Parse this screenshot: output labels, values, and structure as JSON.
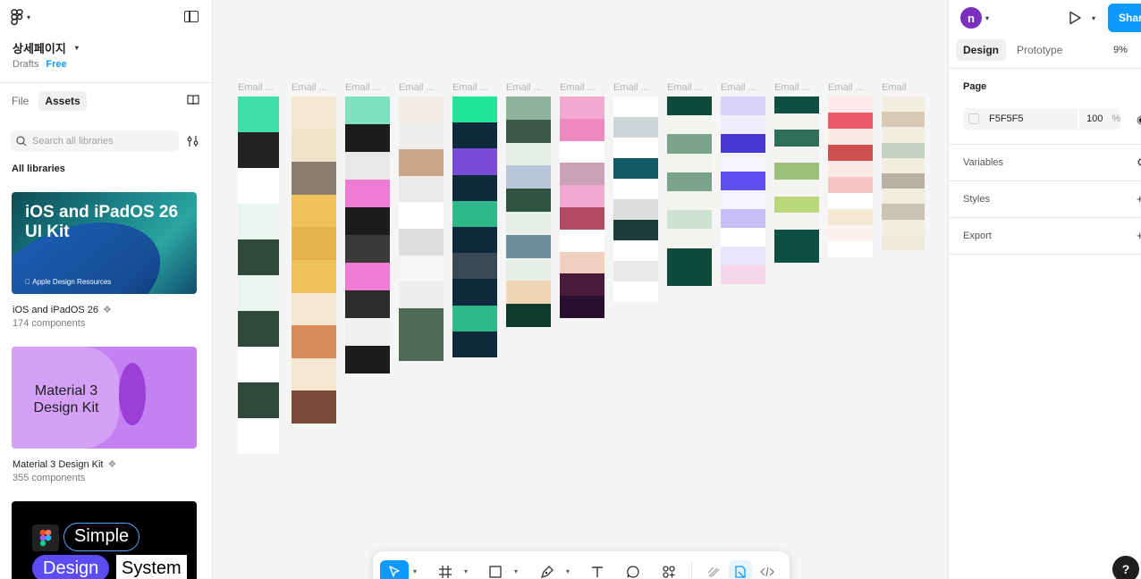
{
  "left_panel": {
    "file_title": "상세페이지",
    "location": "Drafts",
    "plan": "Free",
    "tabs": [
      {
        "label": "File",
        "active": false
      },
      {
        "label": "Assets",
        "active": true
      }
    ],
    "search_placeholder": "Search all libraries",
    "section_heading": "All libraries",
    "libraries": [
      {
        "name": "iOS and iPadOS 26",
        "count": "174 components",
        "thumb_title": "iOS and iPadOS 26 UI Kit",
        "thumb_caption": "Apple Design Resources"
      },
      {
        "name": "Material 3 Design Kit",
        "count": "355 components",
        "thumb_title": "Material 3 Design Kit"
      },
      {
        "name": "Simple Design System",
        "thumb_words": [
          "Simple",
          "Design",
          "System"
        ]
      }
    ]
  },
  "canvas": {
    "frames": [
      {
        "label": "Email ...",
        "theme": "green-stripes"
      },
      {
        "label": "Email ...",
        "theme": "beige-art"
      },
      {
        "label": "Email ...",
        "theme": "dark-pink"
      },
      {
        "label": "Email ...",
        "theme": "skincare"
      },
      {
        "label": "Email ...",
        "theme": "navy-green"
      },
      {
        "label": "Email ...",
        "theme": "travel"
      },
      {
        "label": "Email ...",
        "theme": "black-friday"
      },
      {
        "label": "Email ...",
        "theme": "teal-business"
      },
      {
        "label": "Email ...",
        "theme": "plants"
      },
      {
        "label": "Email ...",
        "theme": "purple-app"
      },
      {
        "label": "Email ...",
        "theme": "eco"
      },
      {
        "label": "Email ...",
        "theme": "valentine"
      },
      {
        "label": "Email",
        "theme": "wedding"
      }
    ],
    "background": "#f5f5f5"
  },
  "toolbar": {
    "tools": [
      "move-tool",
      "frame-tool",
      "shape-tool",
      "pen-tool",
      "text-tool",
      "comment-tool",
      "actions-tool",
      "draw-mode",
      "design-mode",
      "dev-mode"
    ],
    "active_tool": "move-tool"
  },
  "right_panel": {
    "avatar_initial": "n",
    "share_label": "Share",
    "tabs": [
      {
        "label": "Design",
        "active": true
      },
      {
        "label": "Prototype",
        "active": false
      }
    ],
    "zoom": "9%",
    "page_heading": "Page",
    "page_color": "F5F5F5",
    "page_opacity": "100",
    "page_opacity_unit": "%",
    "sections": [
      "Variables",
      "Styles",
      "Export"
    ]
  },
  "help_label": "?",
  "colors": {
    "accent": "#0d99ff",
    "avatar": "#7b2fbe",
    "plan": "#0d99ff"
  }
}
